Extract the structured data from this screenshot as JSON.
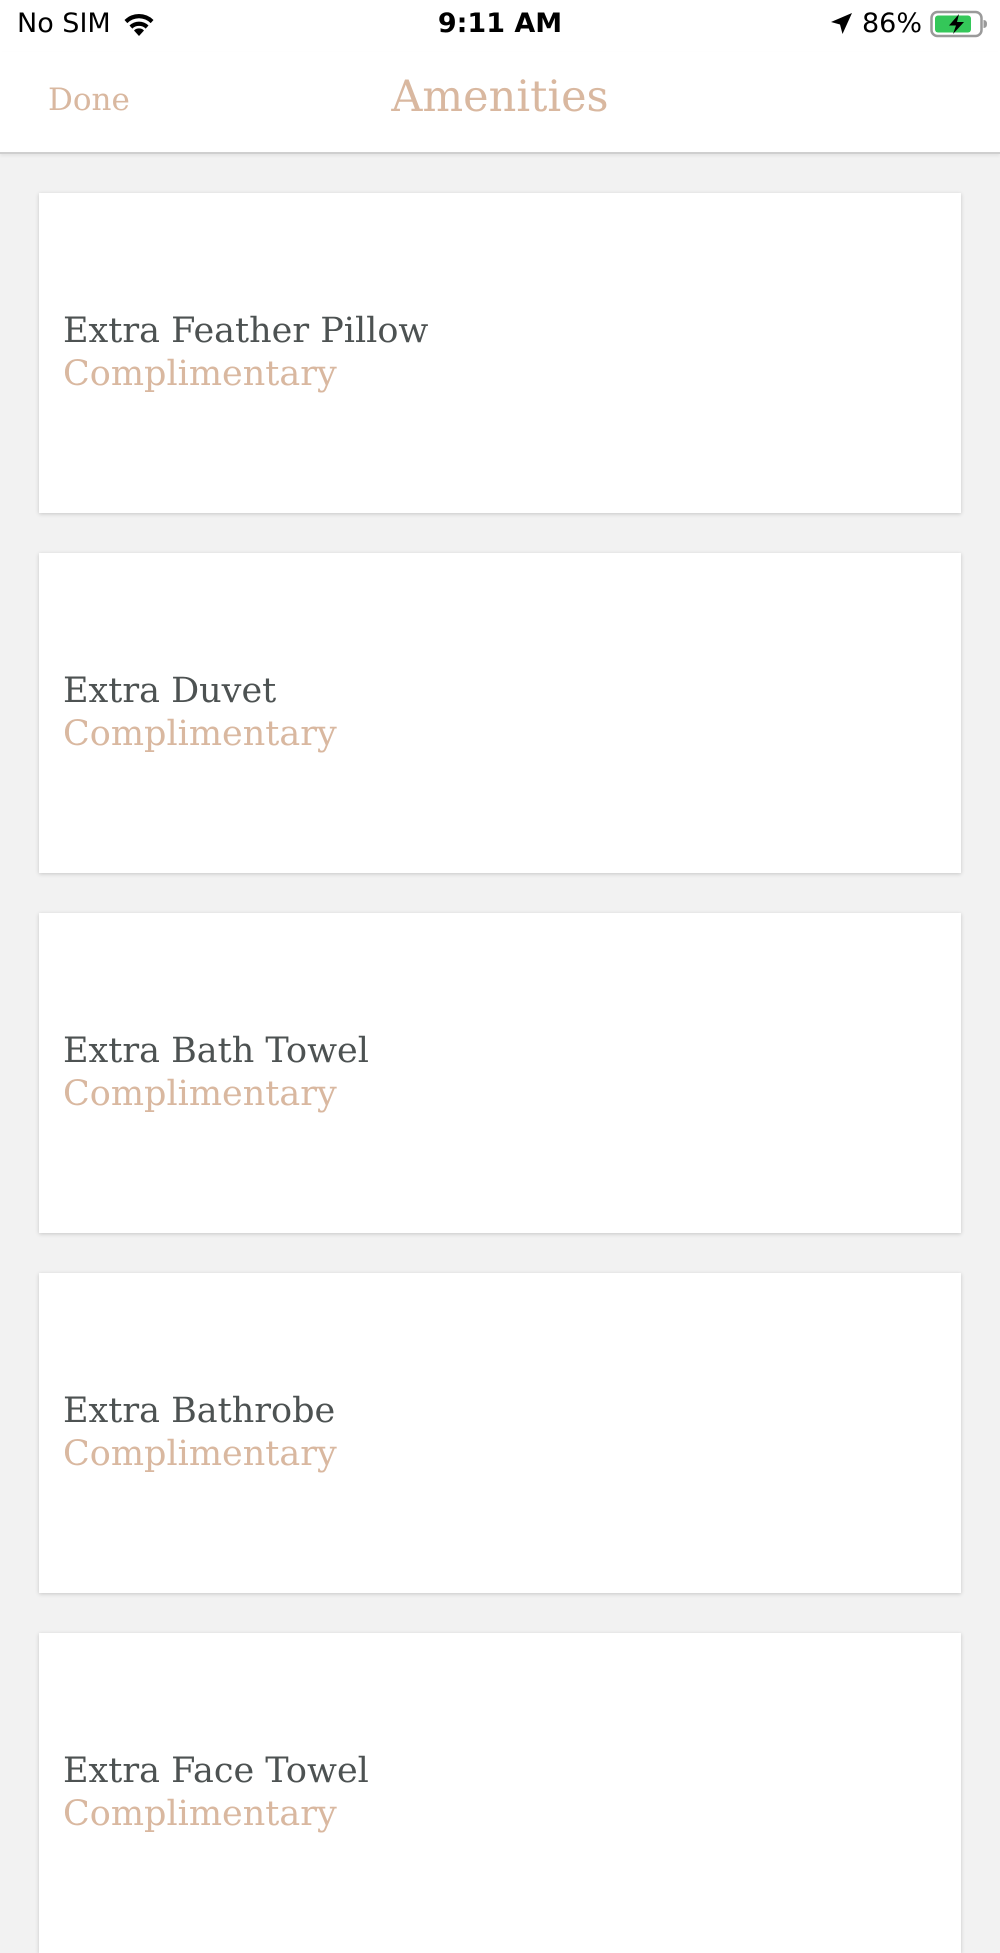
{
  "status_bar": {
    "carrier": "No SIM",
    "time": "9:11 AM",
    "battery_percent": "86%",
    "icons": [
      "wifi-icon",
      "location-arrow-icon",
      "battery-charging-icon"
    ],
    "battery_color": "#34c759"
  },
  "nav": {
    "done_label": "Done",
    "title": "Amenities"
  },
  "colors": {
    "accent": "#d9b8a0",
    "text": "#4d5252",
    "background": "#f2f2f2"
  },
  "amenities": [
    {
      "name": "Extra Feather Pillow",
      "price": "Complimentary"
    },
    {
      "name": "Extra Duvet",
      "price": "Complimentary"
    },
    {
      "name": "Extra Bath Towel",
      "price": "Complimentary"
    },
    {
      "name": "Extra Bathrobe",
      "price": "Complimentary"
    },
    {
      "name": "Extra Face Towel",
      "price": "Complimentary"
    }
  ]
}
